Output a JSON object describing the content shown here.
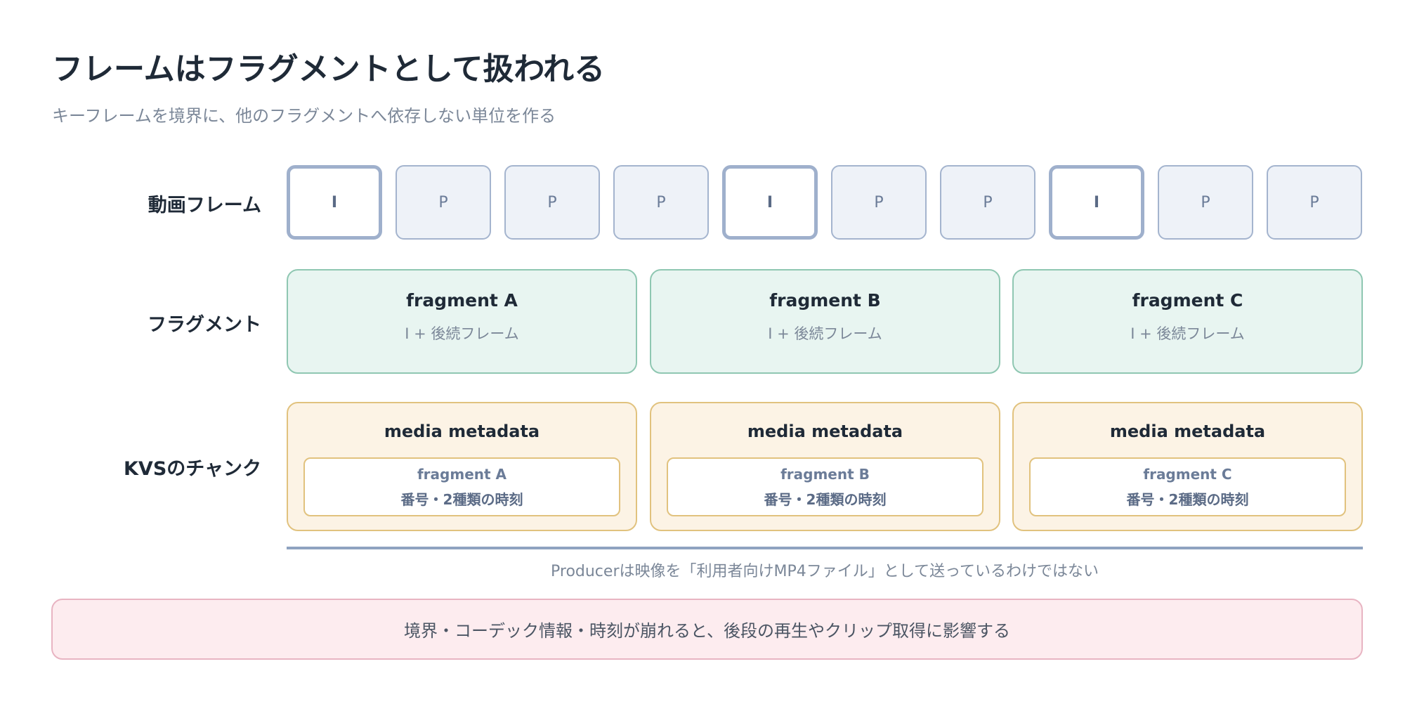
{
  "title": "フレームはフラグメントとして扱われる",
  "subtitle": "キーフレームを境界に、他のフラグメントへ依存しない単位を作る",
  "rows": {
    "frames": "動画フレーム",
    "fragments": "フラグメント",
    "chunks": "KVSのチャンク"
  },
  "frames": [
    "I",
    "P",
    "P",
    "P",
    "I",
    "P",
    "P",
    "I",
    "P",
    "P"
  ],
  "fragments": [
    {
      "name": "fragment A",
      "desc": "I + 後続フレーム"
    },
    {
      "name": "fragment B",
      "desc": "I + 後続フレーム"
    },
    {
      "name": "fragment C",
      "desc": "I + 後続フレーム"
    }
  ],
  "chunks": [
    {
      "title": "media metadata",
      "name": "fragment A",
      "desc": "番号・2種類の時刻"
    },
    {
      "title": "media metadata",
      "name": "fragment B",
      "desc": "番号・2種類の時刻"
    },
    {
      "title": "media metadata",
      "name": "fragment C",
      "desc": "番号・2種類の時刻"
    }
  ],
  "note": "Producerは映像を「利用者向けMP4ファイル」として送っているわけではない",
  "warning": "境界・コーデック情報・時刻が崩れると、後段の再生やクリップ取得に影響する",
  "colors": {
    "keyframe_border": "#9fb0cc",
    "frame_fill": "#eef2f8",
    "fragment_fill": "#e8f5f1",
    "fragment_border": "#8fc7b2",
    "chunk_fill": "#fcf3e5",
    "chunk_border": "#e1c27e",
    "warning_fill": "#fdecef",
    "warning_border": "#e8b4c2"
  }
}
